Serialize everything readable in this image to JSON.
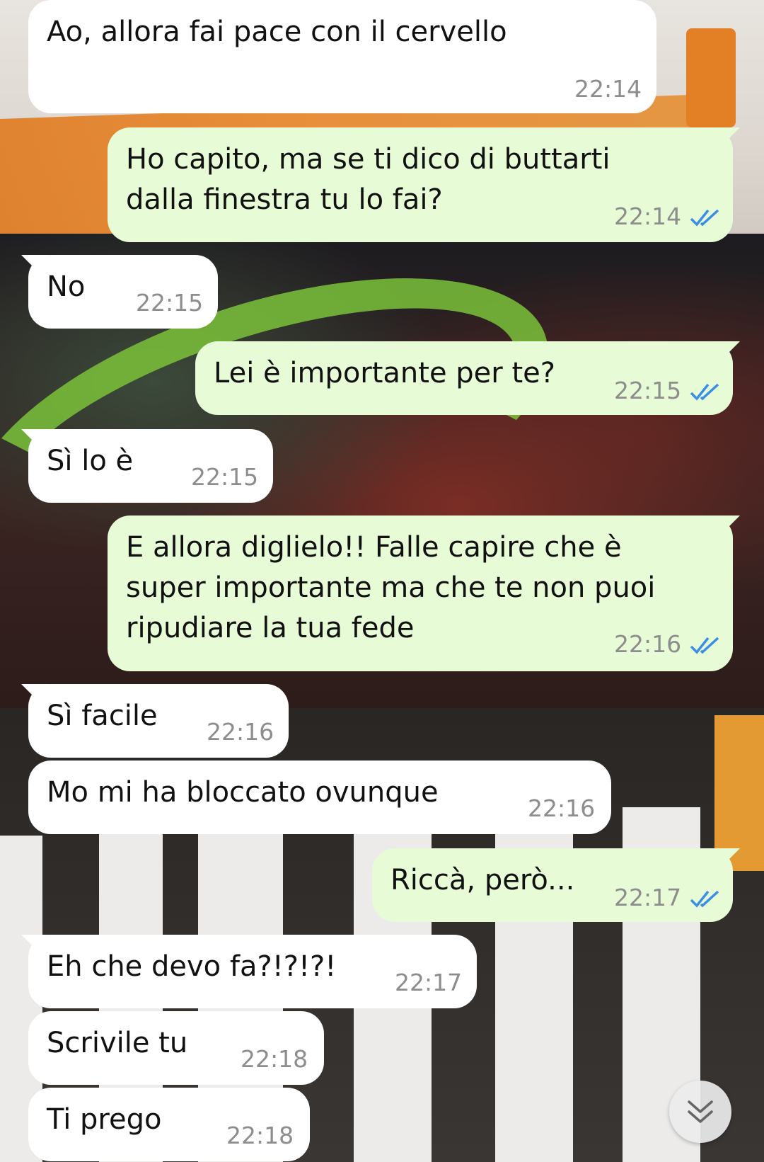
{
  "conversation": {
    "messages": [
      {
        "direction": "in",
        "text": "Ao, allora fai pace con il cervello",
        "time": "22:14"
      },
      {
        "direction": "out",
        "text": "Ho capito, ma se ti dico di buttarti\ndalla finestra tu lo fai?",
        "time": "22:14",
        "status": "read"
      },
      {
        "direction": "in",
        "text": "No",
        "time": "22:15"
      },
      {
        "direction": "out",
        "text": "Lei è importante per te?",
        "time": "22:15",
        "status": "read"
      },
      {
        "direction": "in",
        "text": "Sì lo è",
        "time": "22:15"
      },
      {
        "direction": "out",
        "text": "E allora diglielo!! Falle capire che è\nsuper importante ma che te non puoi\nripudiare la tua fede",
        "time": "22:16",
        "status": "read"
      },
      {
        "direction": "in",
        "text": "Sì facile",
        "time": "22:16"
      },
      {
        "direction": "in",
        "text": "Mo mi ha bloccato ovunque",
        "time": "22:16"
      },
      {
        "direction": "out",
        "text": "Riccà, però...",
        "time": "22:17",
        "status": "read"
      },
      {
        "direction": "in",
        "text": "Eh che devo fa?!?!?!",
        "time": "22:17"
      },
      {
        "direction": "in",
        "text": "Scrivile tu",
        "time": "22:18"
      },
      {
        "direction": "in",
        "text": "Ti prego",
        "time": "22:18"
      }
    ]
  },
  "icons": {
    "read_receipt": "double-check-icon",
    "scroll_down": "chevron-double-down-icon"
  },
  "colors": {
    "incoming_bubble": "#ffffff",
    "outgoing_bubble": "#e7fcd6",
    "read_tick": "#3a8ee6",
    "timestamp": "#8d8d8d"
  }
}
